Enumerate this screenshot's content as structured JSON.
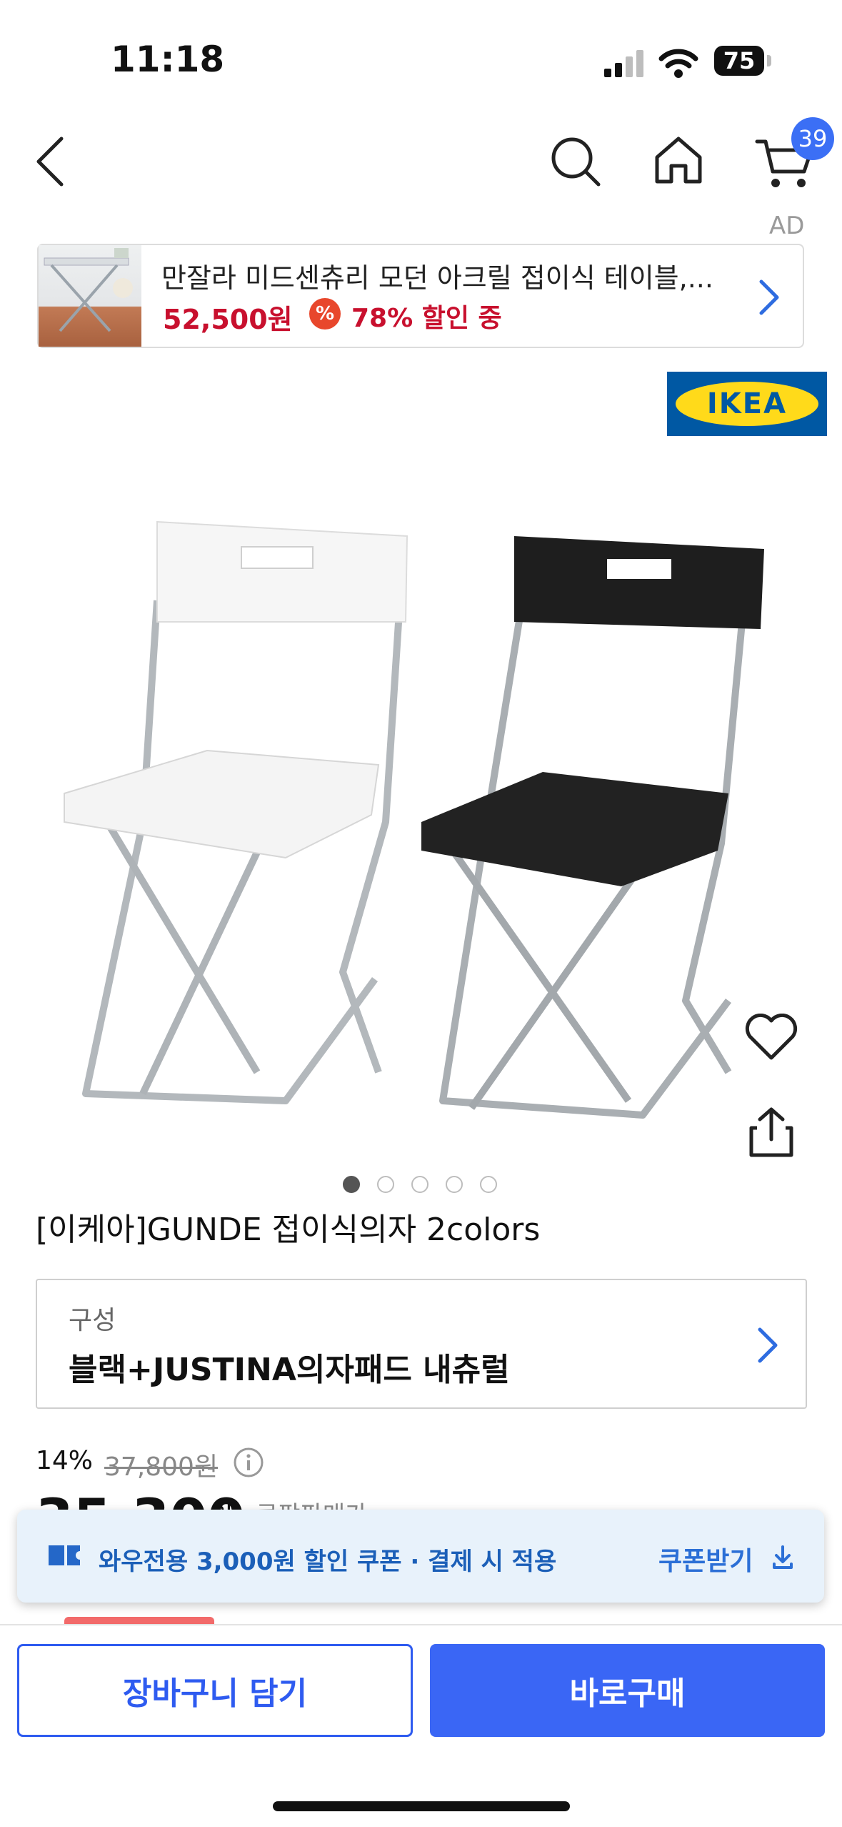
{
  "status_bar": {
    "time": "11:18",
    "battery": "75"
  },
  "nav": {
    "cart_count": "39"
  },
  "ad": {
    "label": "AD",
    "title": "만잘라 미드센츄리 모던 아크릴 접이식 테이블,...",
    "price": "52,500원",
    "pct_icon": "%",
    "discount": "78% 할인 중"
  },
  "brand": {
    "logo_text": "IKEA"
  },
  "gallery": {
    "dots": 5,
    "active_index": 0
  },
  "product": {
    "title": "[이케아]GUNDE 접이식의자 2colors",
    "option_label": "구성",
    "option_value": "블랙+JUSTINA의자패드 내츄럴"
  },
  "price": {
    "discount": "14%",
    "original": "37,800원",
    "sale": "35,300",
    "sale_suffix": "원",
    "sale_label": "쿠팡판매가"
  },
  "coupon": {
    "text": "와우전용 3,000원 할인 쿠폰 · 결제 시 적용",
    "action": "쿠폰받기"
  },
  "actions": {
    "add_to_cart": "장바구니 담기",
    "buy_now": "바로구매"
  },
  "colors": {
    "accent": "#3a66f5",
    "sale_red": "#c8102e",
    "coupon_bg": "#e8f2fb"
  }
}
